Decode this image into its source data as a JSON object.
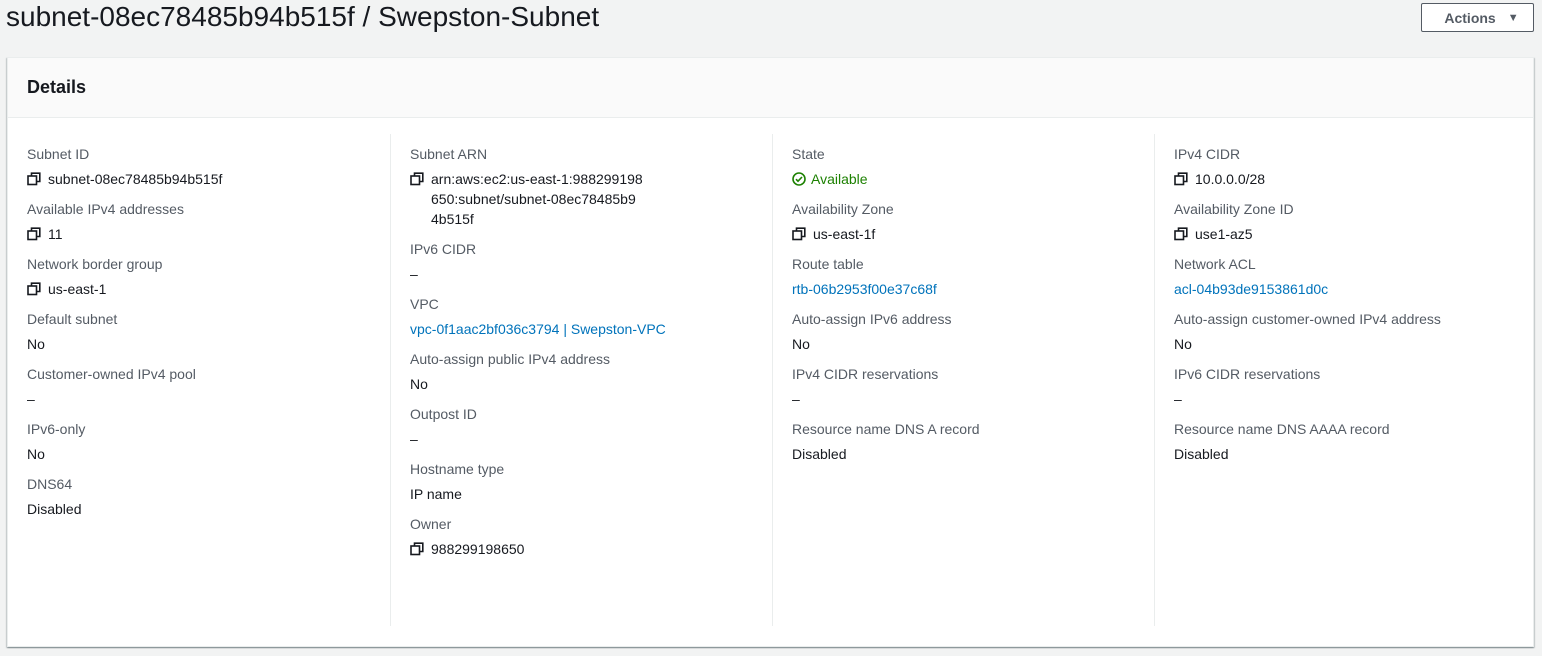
{
  "page": {
    "title": "subnet-08ec78485b94b515f / Swepston-Subnet",
    "actions_label": "Actions"
  },
  "details": {
    "heading": "Details",
    "col1": {
      "subnet_id": {
        "label": "Subnet ID",
        "value": "subnet-08ec78485b94b515f"
      },
      "available_ipv4": {
        "label": "Available IPv4 addresses",
        "value": "11"
      },
      "network_border_group": {
        "label": "Network border group",
        "value": "us-east-1"
      },
      "default_subnet": {
        "label": "Default subnet",
        "value": "No"
      },
      "customer_owned_pool": {
        "label": "Customer-owned IPv4 pool",
        "value": "–"
      },
      "ipv6_only": {
        "label": "IPv6-only",
        "value": "No"
      },
      "dns64": {
        "label": "DNS64",
        "value": "Disabled"
      }
    },
    "col2": {
      "subnet_arn": {
        "label": "Subnet ARN",
        "value": "arn:aws:ec2:us-east-1:988299198650:subnet/subnet-08ec78485b94b515f"
      },
      "ipv6_cidr": {
        "label": "IPv6 CIDR",
        "value": "–"
      },
      "vpc": {
        "label": "VPC",
        "value": "vpc-0f1aac2bf036c3794 | Swepston-VPC"
      },
      "auto_assign_public_ipv4": {
        "label": "Auto-assign public IPv4 address",
        "value": "No"
      },
      "outpost_id": {
        "label": "Outpost ID",
        "value": "–"
      },
      "hostname_type": {
        "label": "Hostname type",
        "value": "IP name"
      },
      "owner": {
        "label": "Owner",
        "value": "988299198650"
      }
    },
    "col3": {
      "state": {
        "label": "State",
        "value": "Available"
      },
      "availability_zone": {
        "label": "Availability Zone",
        "value": "us-east-1f"
      },
      "route_table": {
        "label": "Route table",
        "value": "rtb-06b2953f00e37c68f"
      },
      "auto_assign_ipv6": {
        "label": "Auto-assign IPv6 address",
        "value": "No"
      },
      "ipv4_cidr_reservations": {
        "label": "IPv4 CIDR reservations",
        "value": "–"
      },
      "dns_a_record": {
        "label": "Resource name DNS A record",
        "value": "Disabled"
      }
    },
    "col4": {
      "ipv4_cidr": {
        "label": "IPv4 CIDR",
        "value": "10.0.0.0/28"
      },
      "availability_zone_id": {
        "label": "Availability Zone ID",
        "value": "use1-az5"
      },
      "network_acl": {
        "label": "Network ACL",
        "value": "acl-04b93de9153861d0c"
      },
      "auto_assign_customer_owned": {
        "label": "Auto-assign customer-owned IPv4 address",
        "value": "No"
      },
      "ipv6_cidr_reservations": {
        "label": "IPv6 CIDR reservations",
        "value": "–"
      },
      "dns_aaaa_record": {
        "label": "Resource name DNS AAAA record",
        "value": "Disabled"
      }
    }
  },
  "colors": {
    "link": "#0073bb",
    "success": "#1d8102",
    "label": "#545b64",
    "text": "#16191f"
  },
  "icons": {
    "copy": "copy-icon",
    "status": "status-positive-icon",
    "dropdown": "caret-down-icon"
  }
}
